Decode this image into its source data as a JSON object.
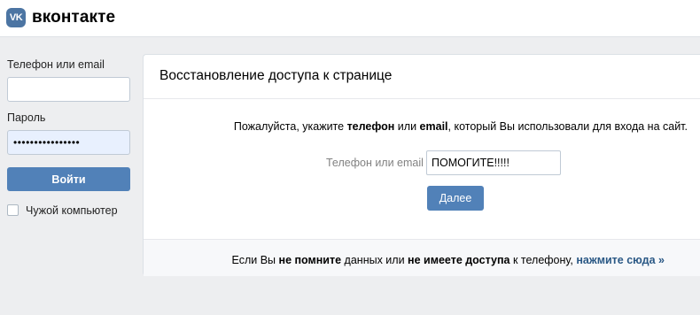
{
  "header": {
    "logo_icon_text": "VK",
    "logo_text": "вконтакте",
    "logo_icon_name": "vk-logo-icon"
  },
  "login": {
    "phone_label": "Телефон или email",
    "phone_value": "",
    "password_label": "Пароль",
    "password_value": "••••••••••••••••",
    "login_button": "Войти",
    "foreign_computer_label": "Чужой компьютер"
  },
  "recovery": {
    "title": "Восстановление доступа к странице",
    "instruction_prefix": "Пожалуйста, укажите ",
    "instruction_phone": "телефон",
    "instruction_or": " или ",
    "instruction_email": "email",
    "instruction_suffix": ", который Вы использовали для входа на сайт.",
    "field_label": "Телефон или email",
    "field_value": "ПОМОГИТЕ!!!!!",
    "next_button": "Далее"
  },
  "footer": {
    "prefix": "Если Вы ",
    "not_remember": "не помните",
    "middle1": " данных или ",
    "no_access": "не имеете доступа",
    "middle2": " к телефону, ",
    "link": "нажмите сюда",
    "arrow": " »"
  },
  "colors": {
    "accent": "#5181b8",
    "link": "#2a5885",
    "background": "#edeef0"
  }
}
